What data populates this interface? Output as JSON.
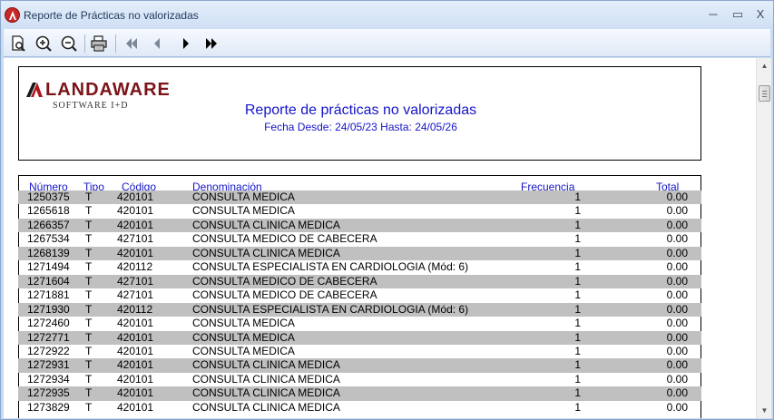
{
  "window": {
    "title": "Reporte de Prácticas no valorizadas",
    "controls": {
      "minimize": "─",
      "maximize": "▭",
      "close": "X"
    }
  },
  "toolbar": {
    "buttons": [
      {
        "name": "page-setup-icon"
      },
      {
        "name": "zoom-in-icon"
      },
      {
        "name": "zoom-out-icon"
      },
      {
        "name": "print-icon"
      },
      {
        "name": "first-page-icon"
      },
      {
        "name": "previous-page-icon"
      },
      {
        "name": "next-page-icon"
      },
      {
        "name": "last-page-icon"
      }
    ]
  },
  "report": {
    "logo": {
      "main": "LANDAWARE",
      "sub": "SOFTWARE I+D"
    },
    "title": "Reporte de prácticas no valorizadas",
    "dates": "Fecha Desde: 24/05/23 Hasta: 24/05/26",
    "columns": {
      "numero": "Número",
      "tipo": "Tipo",
      "codigo": "Código",
      "denominacion": "Denominación",
      "frecuencia": "Frecuencia",
      "total": "Total"
    },
    "rows": [
      {
        "numero": "1250375",
        "tipo": "T",
        "codigo": "420101",
        "denominacion": "CONSULTA MEDICA",
        "frecuencia": "1",
        "total": "0.00"
      },
      {
        "numero": "1265618",
        "tipo": "T",
        "codigo": "420101",
        "denominacion": "CONSULTA MEDICA",
        "frecuencia": "1",
        "total": "0.00"
      },
      {
        "numero": "1266357",
        "tipo": "T",
        "codigo": "420101",
        "denominacion": "CONSULTA CLINICA MEDICA",
        "frecuencia": "1",
        "total": "0.00"
      },
      {
        "numero": "1267534",
        "tipo": "T",
        "codigo": "427101",
        "denominacion": "CONSULTA MEDICO DE CABECERA",
        "frecuencia": "1",
        "total": "0.00"
      },
      {
        "numero": "1268139",
        "tipo": "T",
        "codigo": "420101",
        "denominacion": "CONSULTA CLINICA MEDICA",
        "frecuencia": "1",
        "total": "0.00"
      },
      {
        "numero": "1271494",
        "tipo": "T",
        "codigo": "420112",
        "denominacion": "CONSULTA ESPECIALISTA EN CARDIOLOGIA (Mód: 6)",
        "frecuencia": "1",
        "total": "0.00"
      },
      {
        "numero": "1271604",
        "tipo": "T",
        "codigo": "427101",
        "denominacion": "CONSULTA MEDICO DE CABECERA",
        "frecuencia": "1",
        "total": "0.00"
      },
      {
        "numero": "1271881",
        "tipo": "T",
        "codigo": "427101",
        "denominacion": "CONSULTA MEDICO DE CABECERA",
        "frecuencia": "1",
        "total": "0.00"
      },
      {
        "numero": "1271930",
        "tipo": "T",
        "codigo": "420112",
        "denominacion": "CONSULTA ESPECIALISTA EN CARDIOLOGIA (Mód: 6)",
        "frecuencia": "1",
        "total": "0.00"
      },
      {
        "numero": "1272460",
        "tipo": "T",
        "codigo": "420101",
        "denominacion": "CONSULTA MEDICA",
        "frecuencia": "1",
        "total": "0.00"
      },
      {
        "numero": "1272771",
        "tipo": "T",
        "codigo": "420101",
        "denominacion": "CONSULTA MEDICA",
        "frecuencia": "1",
        "total": "0.00"
      },
      {
        "numero": "1272922",
        "tipo": "T",
        "codigo": "420101",
        "denominacion": "CONSULTA MEDICA",
        "frecuencia": "1",
        "total": "0.00"
      },
      {
        "numero": "1272931",
        "tipo": "T",
        "codigo": "420101",
        "denominacion": "CONSULTA CLINICA MEDICA",
        "frecuencia": "1",
        "total": "0.00"
      },
      {
        "numero": "1272934",
        "tipo": "T",
        "codigo": "420101",
        "denominacion": "CONSULTA CLINICA MEDICA",
        "frecuencia": "1",
        "total": "0.00"
      },
      {
        "numero": "1272935",
        "tipo": "T",
        "codigo": "420101",
        "denominacion": "CONSULTA CLINICA MEDICA",
        "frecuencia": "1",
        "total": "0.00"
      },
      {
        "numero": "1273829",
        "tipo": "T",
        "codigo": "420101",
        "denominacion": "CONSULTA CLINICA MEDICA",
        "frecuencia": "1",
        "total": "0.00"
      }
    ]
  },
  "colors": {
    "report_blue": "#1515c8",
    "row_shade": "#c0c0c0",
    "logo_red": "#7a1418"
  }
}
